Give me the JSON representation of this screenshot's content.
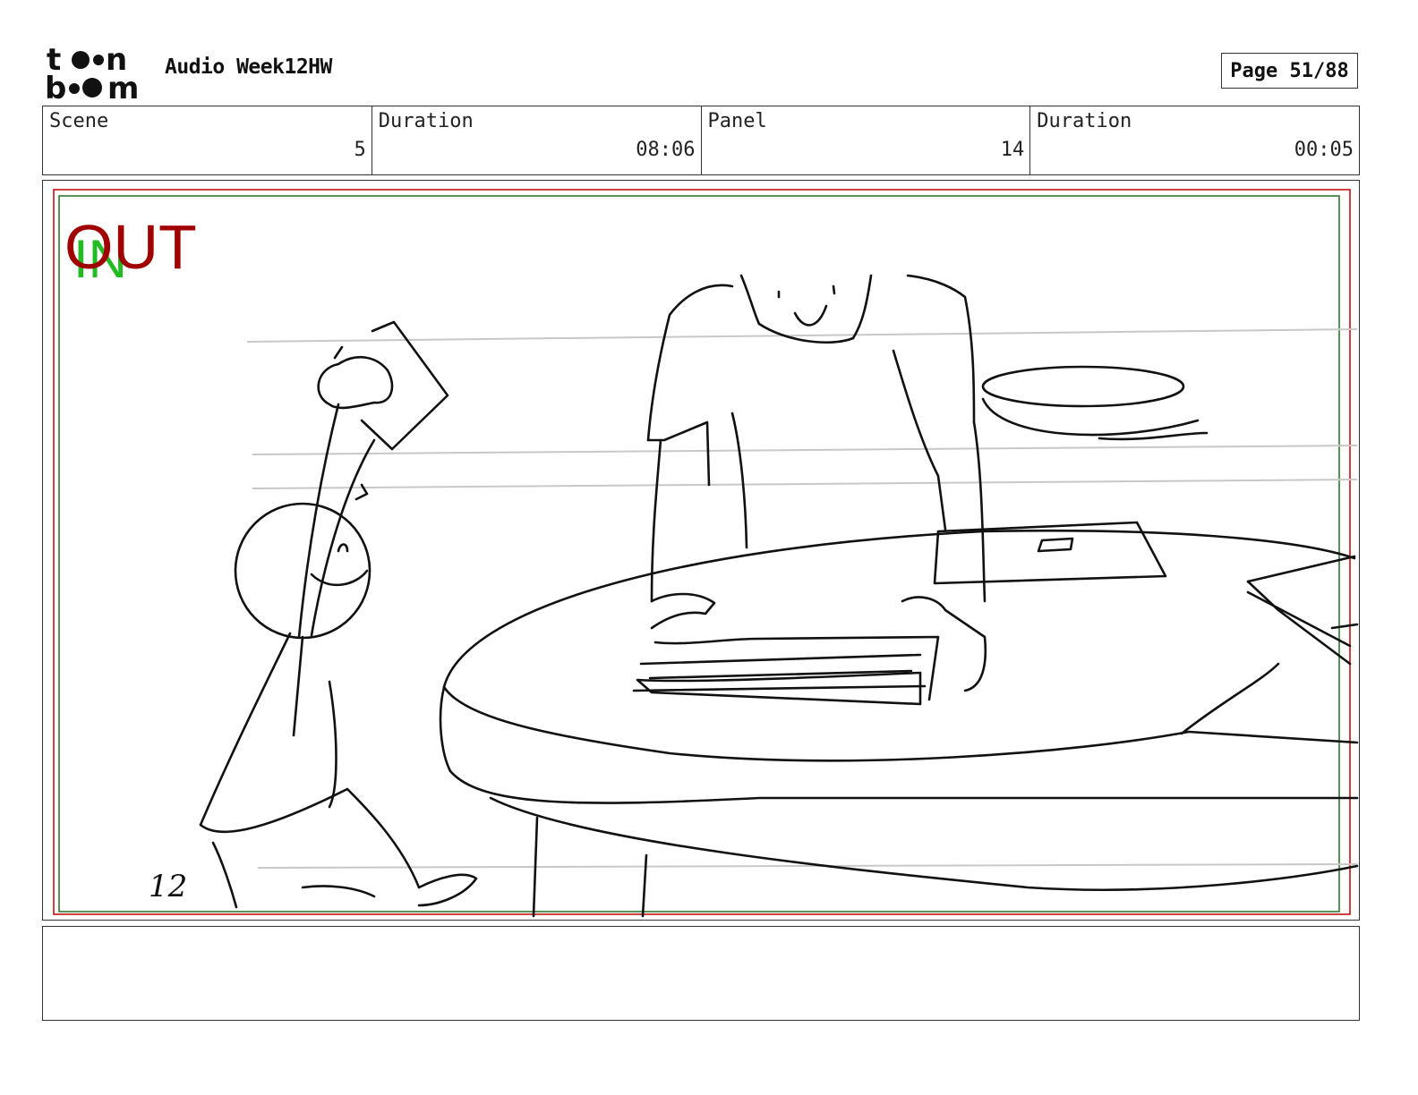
{
  "header": {
    "logo_text_line1": "toon",
    "logo_text_line2": "boom",
    "project_title": "Audio Week12HW",
    "page_indicator": "Page 51/88"
  },
  "info": {
    "scene_label": "Scene",
    "scene_value": "5",
    "scene_duration_label": "Duration",
    "scene_duration_value": "08:06",
    "panel_label": "Panel",
    "panel_value": "14",
    "panel_duration_label": "Duration",
    "panel_duration_value": "00:05"
  },
  "panel": {
    "in_marker": "IN",
    "out_marker": "OUT",
    "sketch_number": "12",
    "colors": {
      "out": "#a00000",
      "in": "#22bb22",
      "frame_red": "#c00000",
      "frame_green": "#207020"
    }
  },
  "caption": {
    "text": ""
  }
}
